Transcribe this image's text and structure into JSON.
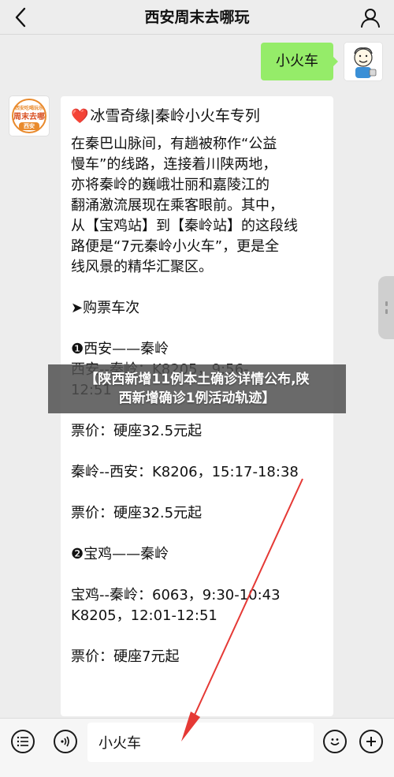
{
  "header": {
    "title": "西安周末去哪玩"
  },
  "conversation": {
    "outgoing": {
      "text": "小火车"
    },
    "brand_avatar": {
      "top_text": "西安吃喝玩乐",
      "mid_text": "周末去哪",
      "bottom_text": "西安"
    },
    "incoming": {
      "title": "冰雪奇缘|秦岭小火车专列",
      "lines": [
        "在秦巴山脉间，有趟被称作“公益",
        "慢车”的线路，连接着川陕两地，",
        "亦将秦岭的巍峨壮丽和嘉陵江的",
        "翻涌激流展现在乘客眼前。其中，",
        "从【宝鸡站】到【秦岭站】的这段线",
        "路便是“7元秦岭小火车”，更是全",
        "线风景的精华汇聚区。",
        "",
        "➤购票车次",
        "",
        "❶西安——秦岭",
        "西安--秦岭：K8205，9:56-",
        "12:51",
        "",
        "票价：硬座32.5元起",
        "",
        "秦岭--西安：K8206，15:17-18:38",
        "",
        "票价：硬座32.5元起",
        "",
        "❷宝鸡——秦岭",
        "",
        "宝鸡--秦岭：6063，9:30-10:43",
        "K8205，12:01-12:51",
        "",
        "票价：硬座7元起"
      ]
    }
  },
  "overlay": {
    "line1": "【陕西新增11例本土确诊详情公布,陕",
    "line2": "西新增确诊1例活动轨迹】"
  },
  "input_bar": {
    "value": "小火车"
  },
  "colors": {
    "bubble_out": "#95ec69",
    "bubble_in": "#ffffff",
    "background": "#ededed",
    "arrow": "#e53935"
  },
  "icons": {
    "back": "chevron-left-icon",
    "profile": "person-icon",
    "menu": "list-icon",
    "voice": "voice-icon",
    "emoji": "smile-icon",
    "plus": "plus-icon"
  }
}
